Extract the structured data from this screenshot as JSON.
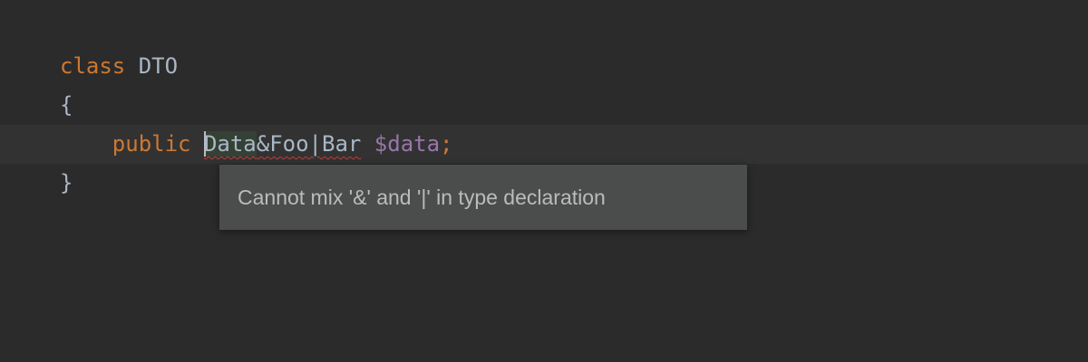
{
  "code": {
    "line1": {
      "keyword": "class",
      "name": "DTO"
    },
    "line2": {
      "brace": "{"
    },
    "line3": {
      "modifier": "public",
      "type_first": "Data",
      "type_rest": "&Foo|Bar",
      "variable": "$data",
      "semicolon": ";"
    },
    "line4": {
      "brace": "}"
    }
  },
  "tooltip": {
    "message": "Cannot mix '&' and '|' in type declaration"
  },
  "colors": {
    "background": "#2b2b2b",
    "keyword": "#cc7832",
    "identifier": "#a9b7c6",
    "variable": "#9876aa",
    "error_underline": "#bc3f3c",
    "tooltip_background": "#4b4d4d"
  }
}
